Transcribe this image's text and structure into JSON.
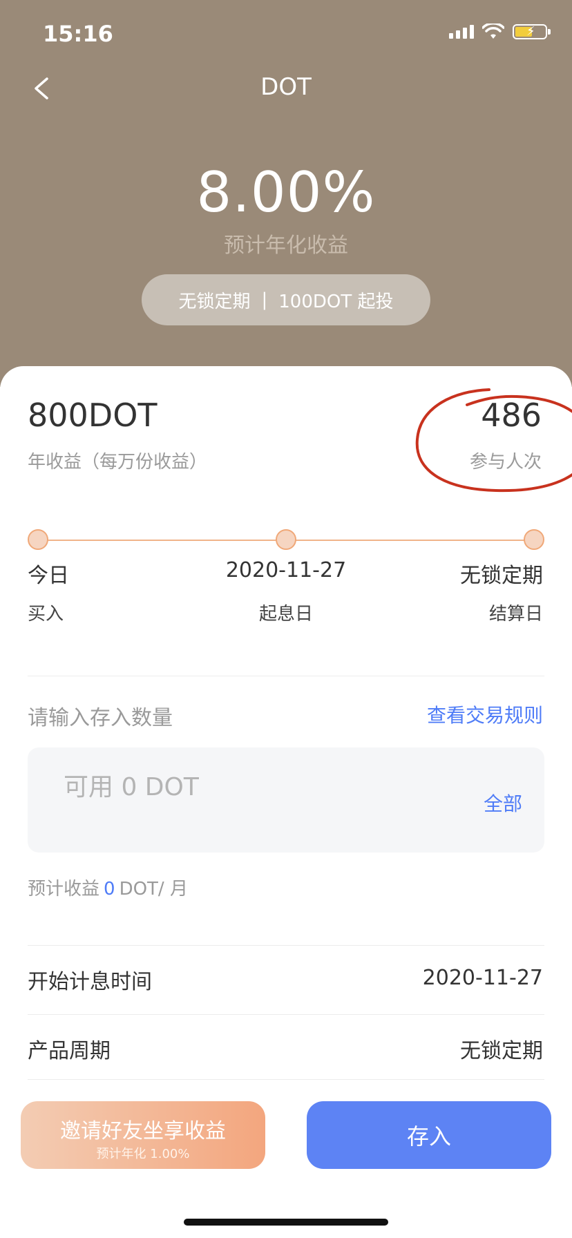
{
  "status_bar": {
    "time": "15:16"
  },
  "header": {
    "title": "DOT",
    "rate": "8.00%",
    "rate_label": "预计年化收益",
    "pill_left": "无锁定期",
    "pill_sep": "|",
    "pill_right": "100DOT 起投"
  },
  "summary": {
    "left_value": "800DOT",
    "left_label": "年收益（每万份收益）",
    "right_value": "486",
    "right_label": "参与人次"
  },
  "timeline": {
    "steps": [
      {
        "title": "今日",
        "sub": "买入"
      },
      {
        "title": "2020-11-27",
        "sub": "起息日"
      },
      {
        "title": "无锁定期",
        "sub": "结算日"
      }
    ]
  },
  "deposit": {
    "label": "请输入存入数量",
    "rules_link": "查看交易规则",
    "placeholder": "可用 0 DOT",
    "all_button": "全部",
    "estimate_prefix": "预计收益",
    "estimate_value": "0",
    "estimate_suffix": "DOT/ 月"
  },
  "info_rows": [
    {
      "label": "开始计息时间",
      "value": "2020-11-27"
    },
    {
      "label": "产品周期",
      "value": "无锁定期"
    }
  ],
  "buttons": {
    "invite_main": "邀请好友坐享收益",
    "invite_sub": "预计年化 1.00%",
    "deposit": "存入"
  },
  "colors": {
    "header_bg": "#9a8a78",
    "accent_blue": "#4f7cf7",
    "deposit_button": "#5d83f4",
    "timeline_orange": "#f0a878",
    "annotation_red": "#c8321e"
  }
}
